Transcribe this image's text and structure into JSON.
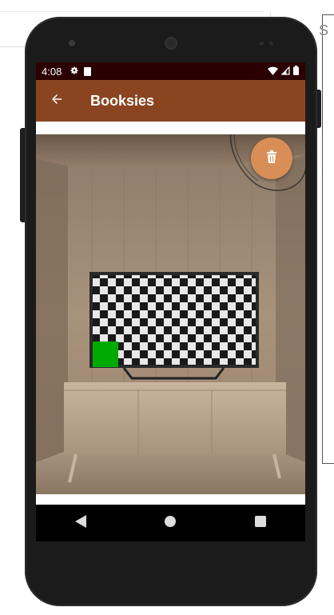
{
  "status_bar": {
    "time": "4:08",
    "icons": [
      "settings-gear",
      "sd-card",
      "wifi",
      "cell-signal",
      "battery"
    ]
  },
  "app_bar": {
    "title": "Booksies",
    "back_icon": "arrow-back",
    "color": "#8a4520"
  },
  "fab": {
    "icon": "trash",
    "color": "#d98e58"
  },
  "photo": {
    "description_icon": "room-tv-scene",
    "marker_color": "#00aa00"
  },
  "nav_bar": {
    "buttons": [
      "back-triangle",
      "home-circle",
      "recents-square"
    ]
  },
  "background": {
    "partial_letter": "S"
  }
}
